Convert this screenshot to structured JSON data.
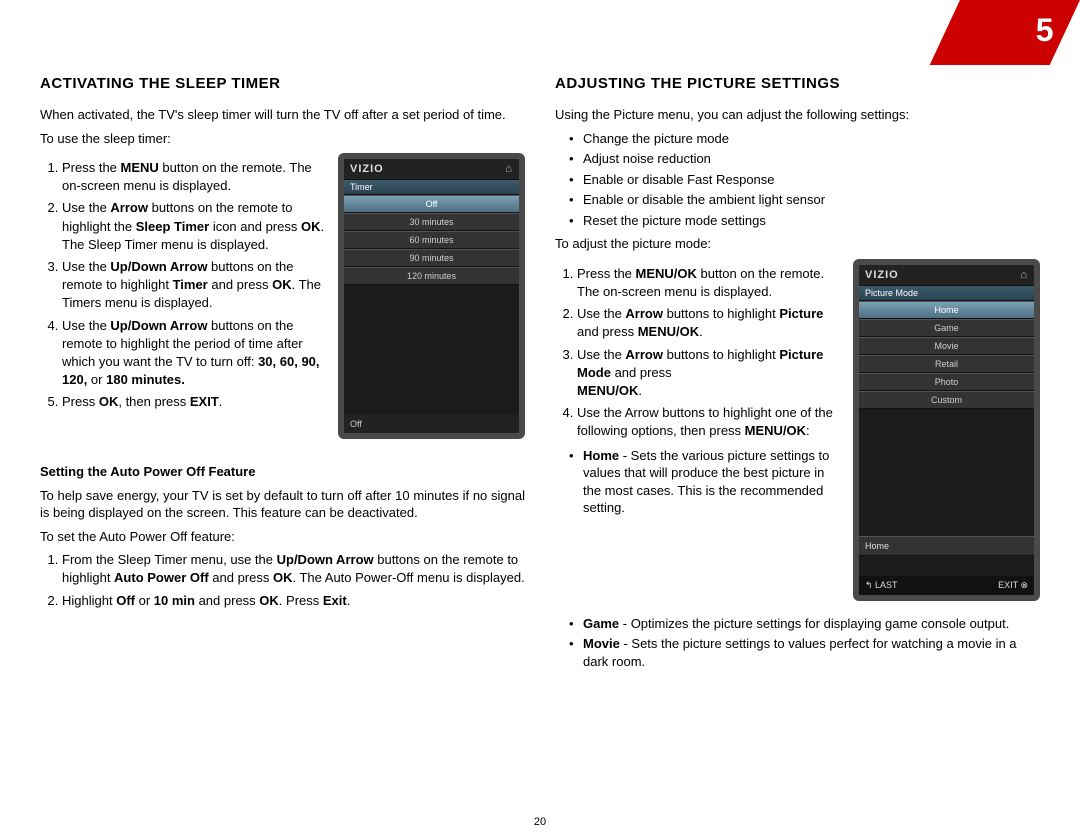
{
  "chapter_number": "5",
  "page_number": "20",
  "left": {
    "heading": "ACTIVATING THE SLEEP TIMER",
    "intro": "When activated, the TV's sleep timer will turn the TV off after a set period of time.",
    "lead": "To use the sleep timer:",
    "steps": {
      "s1a": "Press the ",
      "s1b": "MENU",
      "s1c": " button on the remote. The on-screen menu is displayed.",
      "s2a": "Use the ",
      "s2b": "Arrow",
      "s2c": " buttons on the remote to highlight the ",
      "s2d": "Sleep Timer",
      "s2e": " icon and press ",
      "s2f": "OK",
      "s2g": ". The Sleep Timer menu is displayed.",
      "s3a": "Use the ",
      "s3b": "Up/Down Arrow",
      "s3c": " buttons on the remote to highlight ",
      "s3d": "Timer",
      "s3e": " and press ",
      "s3f": "OK",
      "s3g": ". The Timers menu is displayed.",
      "s4a": "Use the ",
      "s4b": "Up/Down Arrow",
      "s4c": " buttons on the remote to highlight the period of time after which you want the TV to turn off: ",
      "s4d": "30, 60, 90, 120,",
      "s4e": " or ",
      "s4f": "180 minutes.",
      "s5a": "Press ",
      "s5b": "OK",
      "s5c": ", then press ",
      "s5d": "EXIT",
      "s5e": "."
    },
    "sub_heading": "Setting the Auto Power Off Feature",
    "sub_intro": "To help save energy, your TV is set by default to turn off after 10 minutes if no signal is being displayed on the screen. This feature can be deactivated.",
    "sub_lead": "To set the Auto Power Off feature:",
    "sub_steps": {
      "a1a": "From the Sleep Timer menu, use the ",
      "a1b": "Up/Down Arrow",
      "a1c": " buttons on the remote to highlight ",
      "a1d": "Auto Power Off",
      "a1e": " and press ",
      "a1f": "OK",
      "a1g": ". The Auto Power-Off menu is displayed.",
      "a2a": "Highlight ",
      "a2b": "Off",
      "a2c": " or ",
      "a2d": "10 min",
      "a2e": " and press ",
      "a2f": "OK",
      "a2g": ". Press ",
      "a2h": "Exit",
      "a2i": "."
    },
    "phone": {
      "brand": "VIZIO",
      "section": "Timer",
      "items": [
        "Off",
        "30 minutes",
        "60 minutes",
        "90 minutes",
        "120 minutes"
      ],
      "status": "Off"
    }
  },
  "right": {
    "heading": "ADJUSTING THE PICTURE SETTINGS",
    "intro": "Using the Picture menu, you can adjust the following settings:",
    "bullets": [
      "Change the picture mode",
      "Adjust noise reduction",
      "Enable or disable Fast Response",
      "Enable or disable the ambient light sensor",
      "Reset the picture mode settings"
    ],
    "lead": "To adjust the picture mode:",
    "steps": {
      "s1a": "Press the ",
      "s1b": "MENU/OK",
      "s1c": " button on the remote. The on-screen menu is displayed.",
      "s2a": "Use the ",
      "s2b": "Arrow",
      "s2c": " buttons to highlight ",
      "s2d": "Picture",
      "s2e": " and press ",
      "s2f": "MENU/OK",
      "s2g": ".",
      "s3a": "Use the ",
      "s3b": "Arrow",
      "s3c": " buttons to highlight ",
      "s3d": "Picture Mode",
      "s3e": " and press",
      "s3f": "MENU/OK",
      "s3g": ".",
      "s4a": "Use the Arrow buttons to highlight one of the following options, then press ",
      "s4b": "MENU/OK",
      "s4c": ":"
    },
    "options": {
      "o1a": "Home",
      "o1b": " - Sets the various picture settings to values that will produce the best picture in the most cases. This is the recommended setting.",
      "o2a": "Game",
      "o2b": " - Optimizes the picture settings for displaying game console output.",
      "o3a": "Movie",
      "o3b": " - Sets the picture settings to values perfect for watching a movie in a dark room."
    },
    "phone": {
      "brand": "VIZIO",
      "section": "Picture Mode",
      "items": [
        "Home",
        "Game",
        "Movie",
        "Retail",
        "Photo",
        "Custom"
      ],
      "value": "Home",
      "footer_left": "↰ LAST",
      "footer_right": "EXIT ⊗"
    }
  }
}
